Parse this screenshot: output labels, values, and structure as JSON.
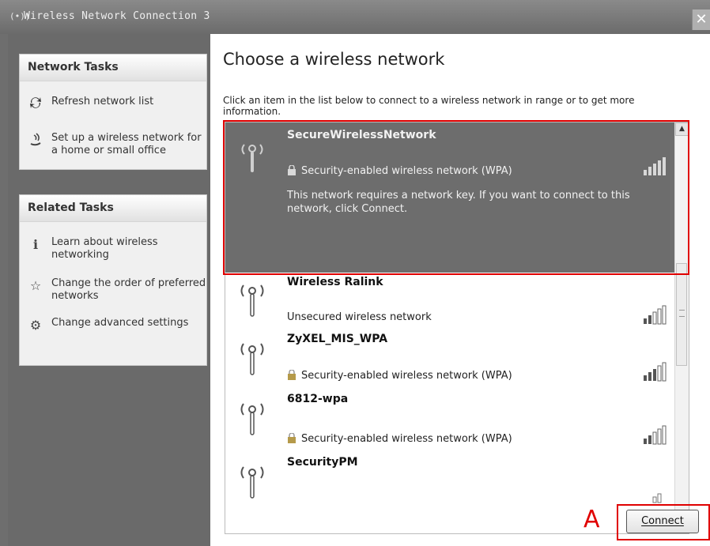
{
  "window": {
    "title": "Wireless Network Connection 3",
    "title_icon": "(•))",
    "close_glyph": "✕"
  },
  "left_pane": {
    "network_tasks": {
      "header": "Network Tasks",
      "items": [
        {
          "icon": "refresh-icon",
          "label": "Refresh network list"
        },
        {
          "icon": "wireless-setup-icon",
          "label": "Set up a wireless network for a home or small office"
        }
      ]
    },
    "related_tasks": {
      "header": "Related Tasks",
      "items": [
        {
          "icon": "info-icon",
          "label": "Learn about wireless networking"
        },
        {
          "icon": "star-icon",
          "label": "Change the order of preferred networks"
        },
        {
          "icon": "settings-icon",
          "label": "Change advanced settings"
        }
      ]
    }
  },
  "main": {
    "heading": "Choose a wireless network",
    "instruction": "Click an item in the list below to connect to a wireless network in range or to get more information.",
    "networks": [
      {
        "name": "SecureWirelessNetwork",
        "status": "Security-enabled wireless network (WPA)",
        "secured": true,
        "selected": true,
        "description": "This network requires a network key. If you want to connect to this network, click Connect.",
        "signal_bars": 5
      },
      {
        "name": "Wireless Ralink",
        "status": "Unsecured wireless network",
        "secured": false,
        "selected": false,
        "signal_bars": 2
      },
      {
        "name": "ZyXEL_MIS_WPA",
        "status": "Security-enabled wireless network (WPA)",
        "secured": true,
        "selected": false,
        "signal_bars": 3
      },
      {
        "name": "6812-wpa",
        "status": "Security-enabled wireless network (WPA)",
        "secured": true,
        "selected": false,
        "signal_bars": 2
      },
      {
        "name": "SecurityPM",
        "status": "",
        "secured": false,
        "selected": false,
        "signal_bars": 1
      }
    ],
    "connect_label": "Connect"
  },
  "annotation": {
    "label": "A",
    "color": "#e00000"
  },
  "colors": {
    "selected_background": "#6d6d6d",
    "left_pane_background": "#6a6a6a"
  }
}
